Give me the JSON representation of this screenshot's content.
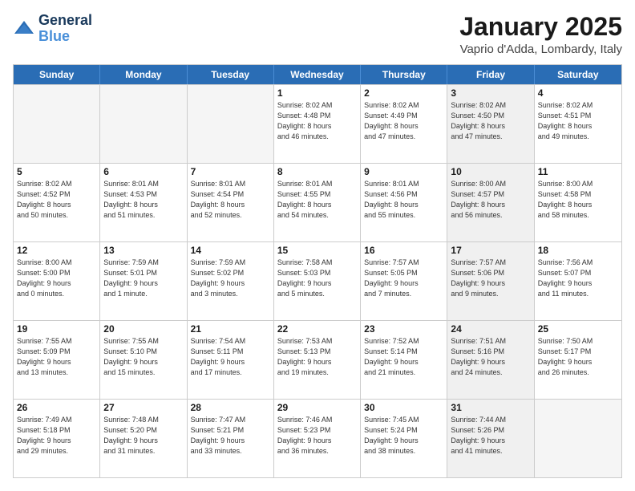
{
  "header": {
    "logo_line1": "General",
    "logo_line2": "Blue",
    "title": "January 2025",
    "subtitle": "Vaprio d'Adda, Lombardy, Italy"
  },
  "calendar": {
    "days_of_week": [
      "Sunday",
      "Monday",
      "Tuesday",
      "Wednesday",
      "Thursday",
      "Friday",
      "Saturday"
    ],
    "rows": [
      [
        {
          "day": "",
          "info": "",
          "empty": true
        },
        {
          "day": "",
          "info": "",
          "empty": true
        },
        {
          "day": "",
          "info": "",
          "empty": true
        },
        {
          "day": "1",
          "info": "Sunrise: 8:02 AM\nSunset: 4:48 PM\nDaylight: 8 hours\nand 46 minutes."
        },
        {
          "day": "2",
          "info": "Sunrise: 8:02 AM\nSunset: 4:49 PM\nDaylight: 8 hours\nand 47 minutes."
        },
        {
          "day": "3",
          "info": "Sunrise: 8:02 AM\nSunset: 4:50 PM\nDaylight: 8 hours\nand 47 minutes.",
          "shaded": true
        },
        {
          "day": "4",
          "info": "Sunrise: 8:02 AM\nSunset: 4:51 PM\nDaylight: 8 hours\nand 49 minutes."
        }
      ],
      [
        {
          "day": "5",
          "info": "Sunrise: 8:02 AM\nSunset: 4:52 PM\nDaylight: 8 hours\nand 50 minutes."
        },
        {
          "day": "6",
          "info": "Sunrise: 8:01 AM\nSunset: 4:53 PM\nDaylight: 8 hours\nand 51 minutes."
        },
        {
          "day": "7",
          "info": "Sunrise: 8:01 AM\nSunset: 4:54 PM\nDaylight: 8 hours\nand 52 minutes."
        },
        {
          "day": "8",
          "info": "Sunrise: 8:01 AM\nSunset: 4:55 PM\nDaylight: 8 hours\nand 54 minutes."
        },
        {
          "day": "9",
          "info": "Sunrise: 8:01 AM\nSunset: 4:56 PM\nDaylight: 8 hours\nand 55 minutes."
        },
        {
          "day": "10",
          "info": "Sunrise: 8:00 AM\nSunset: 4:57 PM\nDaylight: 8 hours\nand 56 minutes.",
          "shaded": true
        },
        {
          "day": "11",
          "info": "Sunrise: 8:00 AM\nSunset: 4:58 PM\nDaylight: 8 hours\nand 58 minutes."
        }
      ],
      [
        {
          "day": "12",
          "info": "Sunrise: 8:00 AM\nSunset: 5:00 PM\nDaylight: 9 hours\nand 0 minutes."
        },
        {
          "day": "13",
          "info": "Sunrise: 7:59 AM\nSunset: 5:01 PM\nDaylight: 9 hours\nand 1 minute."
        },
        {
          "day": "14",
          "info": "Sunrise: 7:59 AM\nSunset: 5:02 PM\nDaylight: 9 hours\nand 3 minutes."
        },
        {
          "day": "15",
          "info": "Sunrise: 7:58 AM\nSunset: 5:03 PM\nDaylight: 9 hours\nand 5 minutes."
        },
        {
          "day": "16",
          "info": "Sunrise: 7:57 AM\nSunset: 5:05 PM\nDaylight: 9 hours\nand 7 minutes."
        },
        {
          "day": "17",
          "info": "Sunrise: 7:57 AM\nSunset: 5:06 PM\nDaylight: 9 hours\nand 9 minutes.",
          "shaded": true
        },
        {
          "day": "18",
          "info": "Sunrise: 7:56 AM\nSunset: 5:07 PM\nDaylight: 9 hours\nand 11 minutes."
        }
      ],
      [
        {
          "day": "19",
          "info": "Sunrise: 7:55 AM\nSunset: 5:09 PM\nDaylight: 9 hours\nand 13 minutes."
        },
        {
          "day": "20",
          "info": "Sunrise: 7:55 AM\nSunset: 5:10 PM\nDaylight: 9 hours\nand 15 minutes."
        },
        {
          "day": "21",
          "info": "Sunrise: 7:54 AM\nSunset: 5:11 PM\nDaylight: 9 hours\nand 17 minutes."
        },
        {
          "day": "22",
          "info": "Sunrise: 7:53 AM\nSunset: 5:13 PM\nDaylight: 9 hours\nand 19 minutes."
        },
        {
          "day": "23",
          "info": "Sunrise: 7:52 AM\nSunset: 5:14 PM\nDaylight: 9 hours\nand 21 minutes."
        },
        {
          "day": "24",
          "info": "Sunrise: 7:51 AM\nSunset: 5:16 PM\nDaylight: 9 hours\nand 24 minutes.",
          "shaded": true
        },
        {
          "day": "25",
          "info": "Sunrise: 7:50 AM\nSunset: 5:17 PM\nDaylight: 9 hours\nand 26 minutes."
        }
      ],
      [
        {
          "day": "26",
          "info": "Sunrise: 7:49 AM\nSunset: 5:18 PM\nDaylight: 9 hours\nand 29 minutes."
        },
        {
          "day": "27",
          "info": "Sunrise: 7:48 AM\nSunset: 5:20 PM\nDaylight: 9 hours\nand 31 minutes."
        },
        {
          "day": "28",
          "info": "Sunrise: 7:47 AM\nSunset: 5:21 PM\nDaylight: 9 hours\nand 33 minutes."
        },
        {
          "day": "29",
          "info": "Sunrise: 7:46 AM\nSunset: 5:23 PM\nDaylight: 9 hours\nand 36 minutes."
        },
        {
          "day": "30",
          "info": "Sunrise: 7:45 AM\nSunset: 5:24 PM\nDaylight: 9 hours\nand 38 minutes."
        },
        {
          "day": "31",
          "info": "Sunrise: 7:44 AM\nSunset: 5:26 PM\nDaylight: 9 hours\nand 41 minutes.",
          "shaded": true
        },
        {
          "day": "",
          "info": "",
          "empty": true
        }
      ]
    ]
  }
}
